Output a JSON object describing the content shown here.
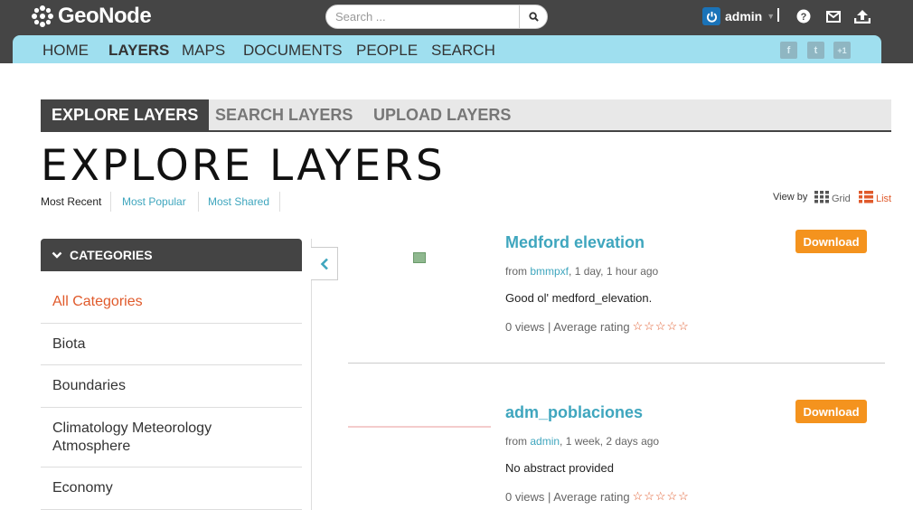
{
  "header": {
    "logo_text": "GeoNode",
    "search_placeholder": "Search ...",
    "username": "admin",
    "icons": [
      "help-icon",
      "mail-icon",
      "upload-icon"
    ]
  },
  "nav": {
    "items": [
      "HOME",
      "LAYERS",
      "MAPS",
      "DOCUMENTS",
      "PEOPLE",
      "SEARCH"
    ],
    "active": "LAYERS",
    "social": [
      "f",
      "t",
      "+1"
    ]
  },
  "subtabs": [
    "EXPLORE LAYERS",
    "SEARCH LAYERS",
    "UPLOAD LAYERS"
  ],
  "page_title": "EXPLORE LAYERS",
  "sort": {
    "items": [
      "Most Recent",
      "Most Popular",
      "Most Shared"
    ],
    "view_by_label": "View by",
    "grid_label": "Grid",
    "list_label": "List"
  },
  "categories": {
    "header": "CATEGORIES",
    "items": [
      "All Categories",
      "Biota",
      "Boundaries",
      "Climatology Meteorology Atmosphere",
      "Economy"
    ]
  },
  "layers": [
    {
      "title": "Medford elevation",
      "from_label": "from",
      "owner": "bmmpxf",
      "age": ", 1 day, 1 hour ago",
      "abstract": "Good ol' medford_elevation.",
      "stats": "0 views | Average rating",
      "download_label": "Download"
    },
    {
      "title": "adm_poblaciones",
      "from_label": "from",
      "owner": "admin",
      "age": ", 1 week, 2 days ago",
      "abstract": "No abstract provided",
      "stats": "0 views | Average rating",
      "download_label": "Download"
    }
  ],
  "colors": {
    "topbar": "#454545",
    "navbar": "#9fdfef",
    "accent": "#3fa6be",
    "download": "#f4931e",
    "active_category": "#e05a2b"
  }
}
